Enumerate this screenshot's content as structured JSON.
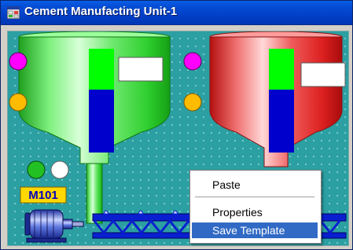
{
  "window": {
    "title": "Cement Manufacting Unit-1"
  },
  "motor": {
    "tag": "M101"
  },
  "context_menu": {
    "items": [
      {
        "label": "Paste",
        "selected": false
      },
      {
        "label": "Properties",
        "selected": false
      },
      {
        "label": "Save Template",
        "selected": true
      }
    ]
  },
  "colors": {
    "title_bar": "#0550d6",
    "canvas": "#2c9fa2",
    "hopper_left": "#33cc33",
    "hopper_right": "#e02020",
    "level_fill": "#0000cc",
    "indicator_magenta": "#ff00ff",
    "indicator_orange": "#ffbb00",
    "indicator_green": "#22c022",
    "indicator_white": "#ffffff",
    "conveyor": "#0a1fd0",
    "menu_highlight": "#316ac5"
  }
}
